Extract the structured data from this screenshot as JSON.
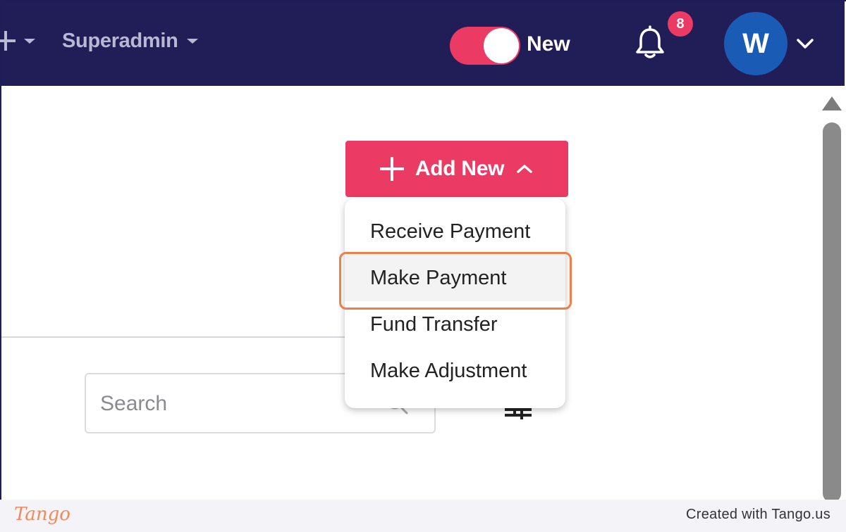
{
  "topbar": {
    "role_label": "Superadmin",
    "toggle_label": "New",
    "notification_count": "8",
    "avatar_initial": "W",
    "toggle_on": true
  },
  "actions": {
    "add_new_label": "Add New"
  },
  "dropdown": {
    "items": [
      {
        "label": "Receive Payment"
      },
      {
        "label": "Make Payment"
      },
      {
        "label": "Fund Transfer"
      },
      {
        "label": "Make Adjustment"
      }
    ],
    "highlighted_item": "Make Payment"
  },
  "search": {
    "placeholder": "Search"
  },
  "footer": {
    "logo_text": "Tango",
    "created_with": "Created with Tango.us"
  },
  "colors": {
    "topbar_bg": "#211e57",
    "accent": "#eb3a63",
    "avatar_bg": "#1a5bb5",
    "highlight_border": "#ee7f4b"
  },
  "icons": {
    "plus": "plus-icon",
    "bell": "bell-icon",
    "search": "search-icon",
    "chevron_up": "chevron-up-icon",
    "chevron_down": "chevron-down-icon",
    "filter": "filter-icon"
  }
}
